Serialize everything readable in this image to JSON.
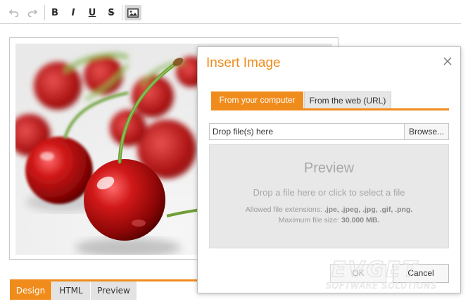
{
  "toolbar": {
    "undo_icon": "undo-icon",
    "redo_icon": "redo-icon",
    "bold": "B",
    "italic": "I",
    "underline": "U",
    "strike": "S",
    "image_icon": "image-icon"
  },
  "modes": {
    "design": "Design",
    "html": "HTML",
    "preview": "Preview"
  },
  "dialog": {
    "title": "Insert Image",
    "tabs": [
      "From your computer",
      "From the web (URL)"
    ],
    "drop_placeholder": "Drop file(s) here",
    "browse": "Browse...",
    "preview_title": "Preview",
    "preview_sub": "Drop a file here or click to select a file",
    "ext_label": "Allowed file extensions: ",
    "ext_values": ".jpe, .jpeg, .jpg, .gif, .png.",
    "size_label": "Maximum file size: ",
    "size_value": "30.000 MB.",
    "ok": "OK",
    "cancel": "Cancel"
  },
  "watermark": {
    "brand": "EVGET",
    "tagline": "SOFTWARE SOLUTIONS"
  },
  "colors": {
    "accent": "#f08c1c"
  }
}
